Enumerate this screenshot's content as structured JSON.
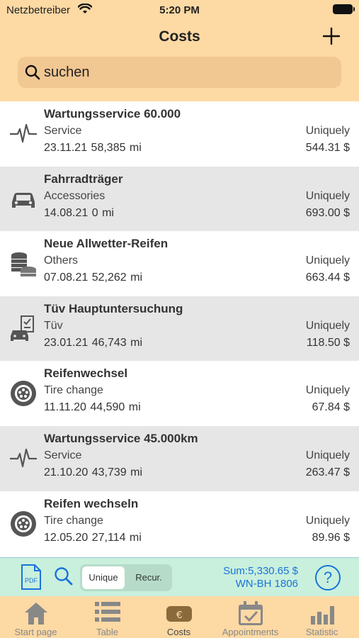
{
  "status": {
    "carrier": "Netzbetreiber",
    "time": "5:20 PM"
  },
  "nav": {
    "title": "Costs"
  },
  "search": {
    "placeholder": "suchen"
  },
  "items": [
    {
      "name": "Wartungsservice 60.000",
      "category": "Service",
      "date": "23.11.21",
      "mileage": "58,385 mi",
      "frequency": "Uniquely",
      "amount": "544.31 $",
      "icon": "pulse-icon"
    },
    {
      "name": "Fahrradträger",
      "category": "Accessories",
      "date": "14.08.21",
      "mileage": "0 mi",
      "frequency": "Uniquely",
      "amount": "693.00 $",
      "icon": "car-icon"
    },
    {
      "name": "Neue Allwetter-Reifen",
      "category": "Others",
      "date": "07.08.21",
      "mileage": "52,262 mi",
      "frequency": "Uniquely",
      "amount": "663.44 $",
      "icon": "coins-icon"
    },
    {
      "name": "Tüv Hauptuntersuchung",
      "category": "Tüv",
      "date": "23.01.21",
      "mileage": "46,743 mi",
      "frequency": "Uniquely",
      "amount": "118.50 $",
      "icon": "inspection-icon"
    },
    {
      "name": "Reifenwechsel",
      "category": "Tire change",
      "date": "11.11.20",
      "mileage": "44,590 mi",
      "frequency": "Uniquely",
      "amount": "67.84 $",
      "icon": "tire-icon"
    },
    {
      "name": "Wartungsservice 45.000km",
      "category": "Service",
      "date": "21.10.20",
      "mileage": "43,739 mi",
      "frequency": "Uniquely",
      "amount": "263.47 $",
      "icon": "pulse-icon"
    },
    {
      "name": "Reifen wechseln",
      "category": "Tire change",
      "date": "12.05.20",
      "mileage": "27,114 mi",
      "frequency": "Uniquely",
      "amount": "89.96 $",
      "icon": "tire-icon"
    }
  ],
  "bottombar": {
    "pdf_label": "PDF",
    "segment_unique": "Unique",
    "segment_recurring": "Recur.",
    "sum": "Sum:5,330.65 $",
    "plate": "WN-BH 1806",
    "help": "?"
  },
  "tabs": [
    {
      "label": "Start page",
      "icon": "home-icon"
    },
    {
      "label": "Table",
      "icon": "list-icon"
    },
    {
      "label": "Costs",
      "icon": "euro-icon",
      "active": true
    },
    {
      "label": "Appointments",
      "icon": "calendar-icon"
    },
    {
      "label": "Statistic",
      "icon": "bar-chart-icon"
    }
  ],
  "colors": {
    "header": "#fdd9a4",
    "bottombar": "#c9f0dd",
    "accent": "#1a73d9",
    "row_alt": "#e6e6e6"
  }
}
